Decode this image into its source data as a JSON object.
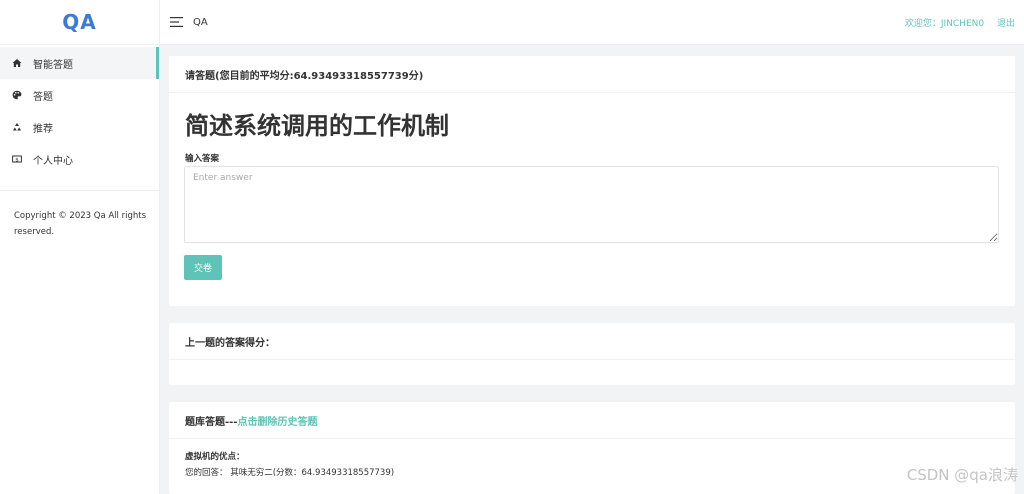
{
  "app": {
    "logo": "QA"
  },
  "sidebar": {
    "items": [
      {
        "label": "智能答题",
        "icon": "home-icon",
        "active": true
      },
      {
        "label": "答题",
        "icon": "palette-icon",
        "active": false
      },
      {
        "label": "推荐",
        "icon": "recycle-icon",
        "active": false
      },
      {
        "label": "个人中心",
        "icon": "dollar-icon",
        "active": false
      }
    ],
    "copyright": "Copyright © 2023 Qa All rights reserved."
  },
  "topbar": {
    "menu_icon": "menu-icon",
    "title": "QA",
    "welcome": "欢迎您：JINCHEN0",
    "logout": "退出"
  },
  "question_card": {
    "header": "请答题(您目前的平均分:64.93493318557739分)",
    "question": "简述系统调用的工作机制",
    "answer_label": "输入答案",
    "answer_value": "",
    "answer_placeholder": "Enter answer",
    "submit_label": "交卷"
  },
  "prev_card": {
    "header": "上一题的答案得分："
  },
  "history_card": {
    "header_prefix": "题库答题---",
    "delete_link": "点击删除历史答题",
    "items": [
      {
        "question": "虚拟机的优点：",
        "answer": "您的回答：  其味无穷二(分数：64.93493318557739)"
      }
    ]
  },
  "watermark": "CSDN @qa浪涛",
  "colors": {
    "accent": "#5fc4b7",
    "logo": "#3a7bd5",
    "background": "#f2f3f5"
  }
}
